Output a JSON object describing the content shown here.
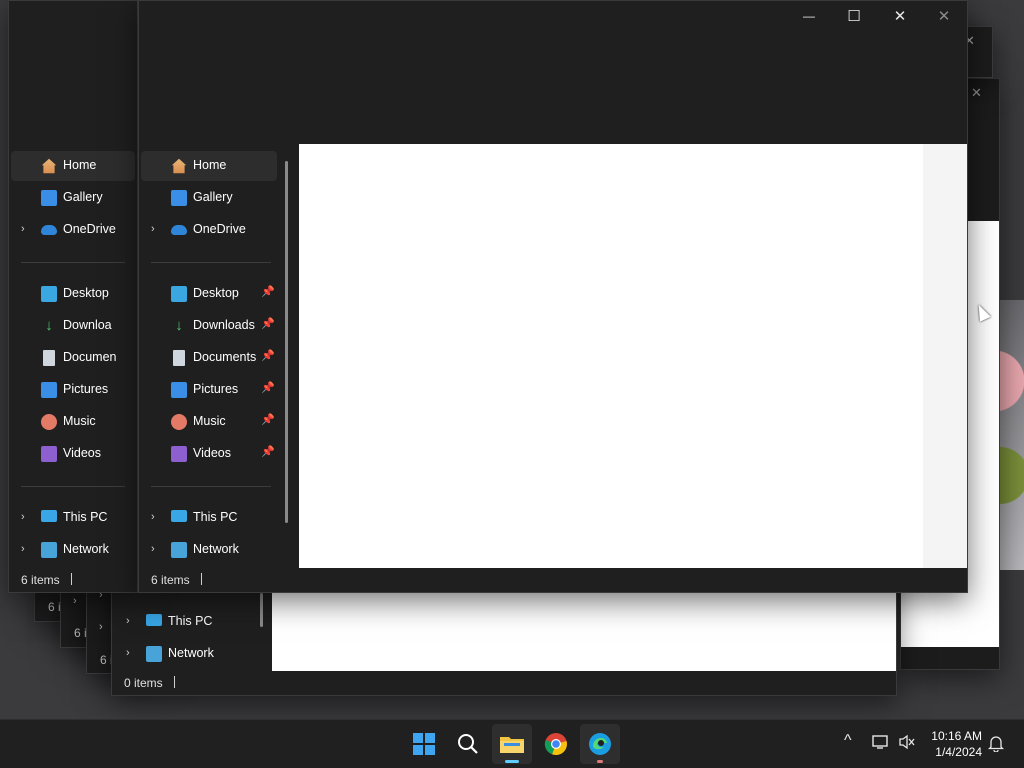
{
  "window_front": {
    "caption": {
      "minimize": "—",
      "maximize": "☐",
      "close": "✕"
    },
    "nav": {
      "home": "Home",
      "gallery": "Gallery",
      "onedrive": "OneDrive",
      "desktop": "Desktop",
      "downloads": "Downloads",
      "documents": "Documents",
      "pictures": "Pictures",
      "music": "Music",
      "videos": "Videos",
      "this_pc": "This PC",
      "network": "Network"
    },
    "status": "6 items"
  },
  "window_left": {
    "nav": {
      "home": "Home",
      "gallery": "Gallery",
      "onedrive": "OneDrive",
      "desktop": "Desktop",
      "downloads": "Downloa",
      "documents": "Documen",
      "pictures": "Pictures",
      "music": "Music",
      "videos": "Videos",
      "this_pc": "This PC",
      "network": "Network"
    },
    "status": "6 items"
  },
  "window_back": {
    "nav": {
      "this_pc": "This PC",
      "network": "Network"
    },
    "status": "0 items"
  },
  "window_peek_status": [
    "6 i",
    "6 i",
    "6 i"
  ],
  "peek_close": "✕",
  "taskbar": {
    "time": "10:16 AM",
    "date": "1/4/2024",
    "tray_chevron": "^"
  }
}
